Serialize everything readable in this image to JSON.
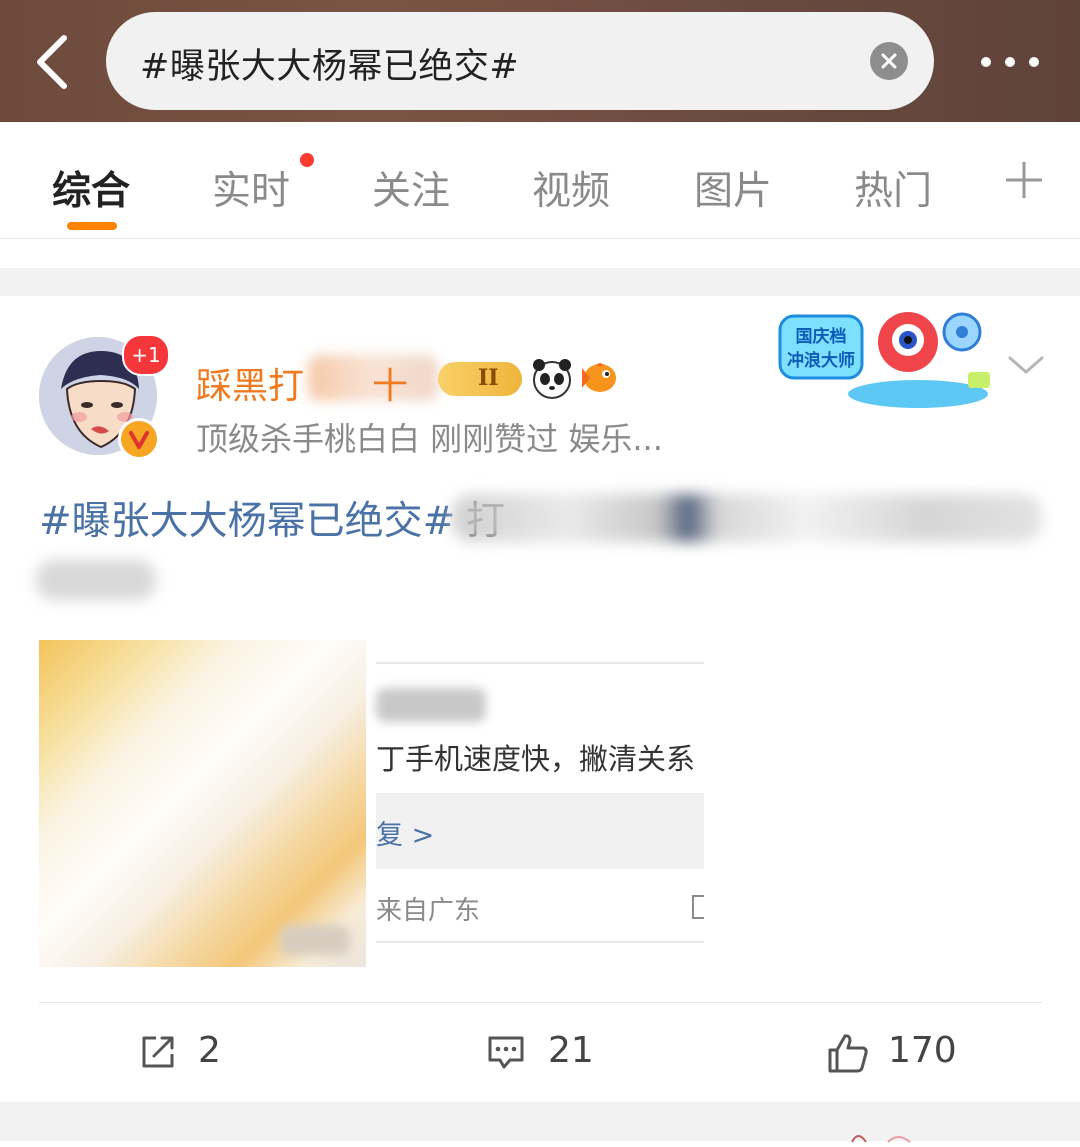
{
  "header": {
    "search_query": "#曝张大大杨幂已绝交#",
    "back_icon": "chevron-left-icon",
    "clear_icon": "clear-icon",
    "more_icon": "more-dots-icon"
  },
  "tabs": [
    {
      "label": "综合",
      "active": true
    },
    {
      "label": "实时",
      "has_dot": true
    },
    {
      "label": "关注"
    },
    {
      "label": "视频"
    },
    {
      "label": "图片"
    },
    {
      "label": "热门"
    }
  ],
  "tabs_add_icon": "plus-icon",
  "colors": {
    "accent": "#ff8200",
    "username": "#f07a1f",
    "link": "#4a72a6",
    "badge": "#f5373b"
  },
  "post": {
    "avatar_badge": "+1",
    "username_visible": "踩黑打",
    "username_trailing": "十",
    "level_label": "II",
    "subtitle": "顶级杀手桃白白 刚刚赞过  娱乐...",
    "hashtag": "#曝张大大杨幂已绝交#",
    "body_visible_tail": "打",
    "screenshot": {
      "line1": "丁手机速度快，撇清关系",
      "reply": "复 >",
      "from": "来自广东"
    },
    "actions": {
      "repost_count": "2",
      "comment_count": "21",
      "like_count": "170"
    },
    "sticker_text_1": "国庆档",
    "sticker_text_2": "冲浪大师"
  }
}
